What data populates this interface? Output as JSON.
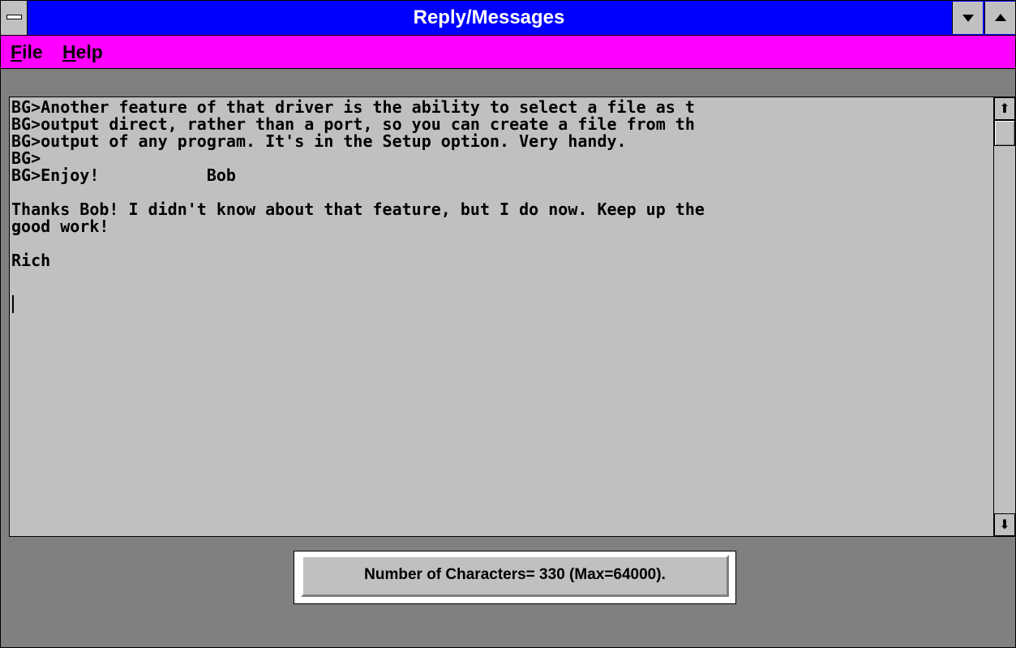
{
  "window": {
    "title": "Reply/Messages",
    "system_menu_icon": "system-menu-icon",
    "minimize_icon": "minimize-arrow-icon",
    "maximize_icon": "maximize-arrow-icon"
  },
  "menu": {
    "items": [
      {
        "mnemonic": "F",
        "rest": "ile"
      },
      {
        "mnemonic": "H",
        "rest": "elp"
      }
    ]
  },
  "editor": {
    "text": "BG>Another feature of that driver is the ability to select a file as t\nBG>output direct, rather than a port, so you can create a file from th\nBG>output of any program. It's in the Setup option. Very handy.\nBG>\nBG>Enjoy!           Bob\n\nThanks Bob! I didn't know about that feature, but I do now. Keep up the\ngood work!\n\nRich",
    "scroll_up_glyph": "⬆",
    "scroll_down_glyph": "⬇"
  },
  "status": {
    "text": "Number of Characters= 330 (Max=64000)."
  },
  "colors": {
    "title_bar": "#0000ff",
    "menu_bar": "#ff00ff",
    "window_background": "#808080",
    "editor_background": "#c0c0c0"
  }
}
